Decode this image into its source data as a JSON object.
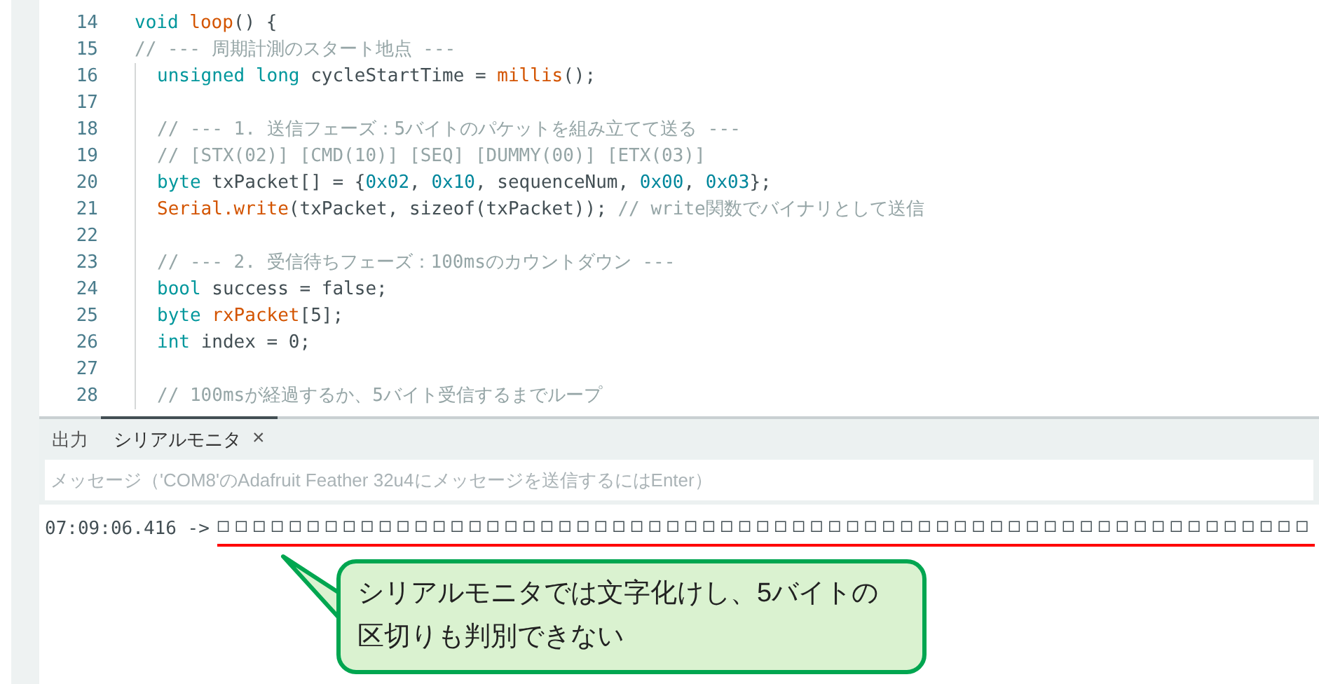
{
  "editor": {
    "lines": [
      {
        "number": "14",
        "tokens": [
          {
            "text": "void ",
            "kind": "keyword"
          },
          {
            "text": "loop",
            "kind": "function"
          },
          {
            "text": "() {",
            "kind": "plain"
          }
        ]
      },
      {
        "number": "15",
        "tokens": [
          {
            "text": "// --- 周期計測のスタート地点 ---",
            "kind": "comment"
          }
        ],
        "children": [
          {
            "number": "16",
            "tokens": [
              {
                "text": "unsigned long ",
                "kind": "keyword"
              },
              {
                "text": "cycleStartTime = ",
                "kind": "plain"
              },
              {
                "text": "millis",
                "kind": "function"
              },
              {
                "text": "();",
                "kind": "plain"
              }
            ]
          },
          {
            "number": "17"
          },
          {
            "number": "18",
            "tokens": [
              {
                "text": "// --- 1. 送信フェーズ：5バイトのパケットを組み立てて送る ---",
                "kind": "comment"
              }
            ]
          },
          {
            "number": "19",
            "tokens": [
              {
                "text": "// [STX(02)] [CMD(10)] [SEQ] [DUMMY(00)] [ETX(03)]",
                "kind": "comment"
              }
            ]
          },
          {
            "number": "20",
            "tokens": [
              {
                "text": "byte ",
                "kind": "keyword"
              },
              {
                "text": "txPacket[] = {",
                "kind": "plain"
              },
              {
                "text": "0x02",
                "kind": "literal"
              },
              {
                "text": ", ",
                "kind": "plain"
              },
              {
                "text": "0x10",
                "kind": "literal"
              },
              {
                "text": ", sequenceNum, ",
                "kind": "plain"
              },
              {
                "text": "0x00",
                "kind": "literal"
              },
              {
                "text": ", ",
                "kind": "plain"
              },
              {
                "text": "0x03",
                "kind": "literal"
              },
              {
                "text": "};",
                "kind": "plain"
              }
            ]
          },
          {
            "number": "21",
            "tokens": [
              {
                "text": "Serial.write",
                "kind": "function"
              },
              {
                "text": "(txPacket, sizeof(txPacket)); ",
                "kind": "plain"
              },
              {
                "text": "// write関数でバイナリとして送信",
                "kind": "comment"
              }
            ]
          },
          {
            "number": "22"
          },
          {
            "number": "23",
            "tokens": [
              {
                "text": "// --- 2. 受信待ちフェーズ：100msのカウントダウン ---",
                "kind": "comment"
              }
            ]
          },
          {
            "number": "24",
            "tokens": [
              {
                "text": "bool ",
                "kind": "keyword"
              },
              {
                "text": "success = false;",
                "kind": "plain"
              }
            ]
          },
          {
            "number": "25",
            "tokens": [
              {
                "text": "byte ",
                "kind": "keyword"
              },
              {
                "text": "rxPacket",
                "kind": "function"
              },
              {
                "text": "[5];",
                "kind": "plain"
              }
            ]
          },
          {
            "number": "26",
            "tokens": [
              {
                "text": "int ",
                "kind": "keyword"
              },
              {
                "text": "index = 0;",
                "kind": "plain"
              }
            ]
          },
          {
            "number": "27"
          },
          {
            "number": "28",
            "tokens": [
              {
                "text": "// 100msが経過するか、5バイト受信するまでループ",
                "kind": "comment"
              }
            ]
          }
        ]
      }
    ]
  },
  "panel": {
    "tabs": [
      {
        "label": "出力",
        "selected": false,
        "closable": false
      },
      {
        "label": "シリアルモニタ",
        "selected": true,
        "closable": true,
        "close": "×"
      }
    ],
    "message_field": {
      "placeholder": "メッセージ（'COM8'のAdafruit Feather 32u4にメッセージを送信するにはEnter）"
    },
    "output": [
      {
        "timestamp": "07:09:06.416 ->",
        "text": "□□□□□□□□□□□□□□□□□□□□□□□□□□□□□□□□□□□□□□□□□□□□□□□□□□□□□□□□□□□□□",
        "underlined": true
      }
    ]
  },
  "callout": {
    "text": "シリアルモニタでは文字化けし、5バイトの区切りも判別できない"
  }
}
